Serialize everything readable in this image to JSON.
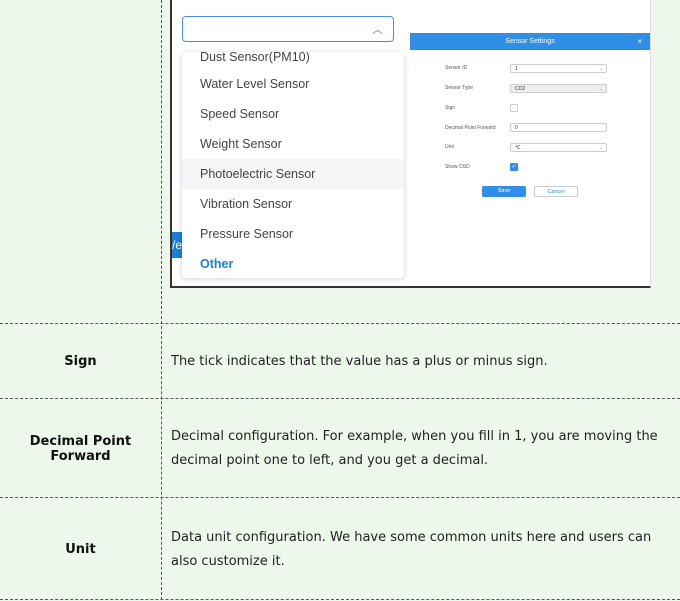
{
  "dropdown": {
    "options": [
      "Dust Sensor(PM10)",
      "Water Level Sensor",
      "Speed Sensor",
      "Weight Sensor",
      "Photoelectric Sensor",
      "Vibration Sensor",
      "Pressure Sensor",
      "Other"
    ],
    "highlighted": "Photoelectric Sensor",
    "selected": "Other"
  },
  "modal": {
    "title": "Sensor Settings",
    "close": "×",
    "fields": {
      "sensor_id": {
        "label": "Sensor ID",
        "value": "1"
      },
      "sensor_type": {
        "label": "Sensor Type",
        "value": "CO2"
      },
      "sign": {
        "label": "Sign",
        "checked": false
      },
      "decimal": {
        "label": "Decimal Point Forward",
        "value": "0"
      },
      "unit": {
        "label": "Unit",
        "value": "℃"
      },
      "show_osd": {
        "label": "Show OSD",
        "checked": true
      }
    },
    "save": "Save",
    "cancel": "Cancel"
  },
  "rows": [
    {
      "param": "Sign",
      "desc": "The tick indicates that the value has a plus or minus sign."
    },
    {
      "param": "Decimal Point Forward",
      "desc": "Decimal configuration. For example, when you fill in 1, you are moving the decimal point one to left, and you get a decimal."
    },
    {
      "param": "Unit",
      "desc": "Data unit configuration. We have some common units here and users can also customize it."
    }
  ],
  "colors": {
    "accent": "#1d7fd6",
    "page_bg": "#eef7ec"
  }
}
